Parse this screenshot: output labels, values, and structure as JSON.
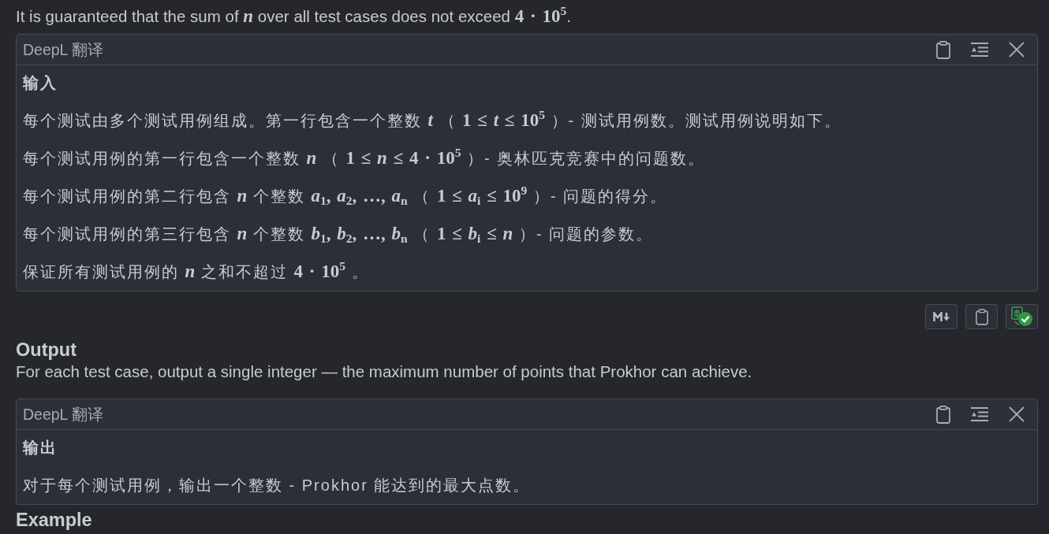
{
  "input_tail": {
    "segments": [
      {
        "kind": "text",
        "text": "It is guaranteed that the sum of "
      },
      {
        "kind": "math",
        "text": "*n*"
      },
      {
        "kind": "text",
        "text": " over all test cases does not exceed "
      },
      {
        "kind": "math",
        "text": "4 · 10$^{5}$"
      },
      {
        "kind": "text",
        "text": "."
      }
    ]
  },
  "input_translation": {
    "header": "DeepL 翻译",
    "heading": "输入",
    "paragraphs": [
      {
        "segments": [
          {
            "kind": "text",
            "text": "每个测试由多个测试用例组成。第一行包含一个整数 "
          },
          {
            "kind": "math",
            "text": "*t*"
          },
          {
            "kind": "text",
            "text": " （ "
          },
          {
            "kind": "math",
            "text": "1 ≤ *t* ≤ 10$^{5}$"
          },
          {
            "kind": "text",
            "text": " ）- 测试用例数。测试用例说明如下。"
          }
        ]
      },
      {
        "segments": [
          {
            "kind": "text",
            "text": "每个测试用例的第一行包含一个整数 "
          },
          {
            "kind": "math",
            "text": "*n*"
          },
          {
            "kind": "text",
            "text": " （ "
          },
          {
            "kind": "math",
            "text": "1 ≤ *n* ≤ 4 · 10$^{5}$"
          },
          {
            "kind": "text",
            "text": " ）- 奥林匹克竞赛中的问题数。"
          }
        ]
      },
      {
        "segments": [
          {
            "kind": "text",
            "text": "每个测试用例的第二行包含 "
          },
          {
            "kind": "math",
            "text": "*n*"
          },
          {
            "kind": "text",
            "text": " 个整数 "
          },
          {
            "kind": "math",
            "text": "*a*$_{1}$, *a*$_{2}$, …, *a*$_{n}$"
          },
          {
            "kind": "text",
            "text": " （ "
          },
          {
            "kind": "math",
            "text": "1 ≤ *a*$_{i}$ ≤ 10$^{9}$"
          },
          {
            "kind": "text",
            "text": " ）- 问题的得分。"
          }
        ]
      },
      {
        "segments": [
          {
            "kind": "text",
            "text": "每个测试用例的第三行包含 "
          },
          {
            "kind": "math",
            "text": "*n*"
          },
          {
            "kind": "text",
            "text": " 个整数 "
          },
          {
            "kind": "math",
            "text": "*b*$_{1}$, *b*$_{2}$, …, *b*$_{n}$"
          },
          {
            "kind": "text",
            "text": " （ "
          },
          {
            "kind": "math",
            "text": "1 ≤ *b*$_{i}$ ≤ *n*"
          },
          {
            "kind": "text",
            "text": " ）- 问题的参数。"
          }
        ]
      },
      {
        "segments": [
          {
            "kind": "text",
            "text": "保证所有测试用例的 "
          },
          {
            "kind": "math",
            "text": "*n*"
          },
          {
            "kind": "text",
            "text": " 之和不超过 "
          },
          {
            "kind": "math",
            "text": "4 · 10$^{5}$"
          },
          {
            "kind": "text",
            "text": " 。"
          }
        ]
      }
    ]
  },
  "output_section": {
    "title": "Output",
    "text": "For each test case, output a single integer — the maximum number of points that Prokhor can achieve."
  },
  "output_translation": {
    "header": "DeepL 翻译",
    "heading": "输出",
    "paragraphs": [
      {
        "segments": [
          {
            "kind": "text",
            "text": "对于每个测试用例，输出一个整数 - Prokhor 能达到的最大点数。"
          }
        ]
      }
    ]
  },
  "next_section": {
    "title": "Example"
  }
}
